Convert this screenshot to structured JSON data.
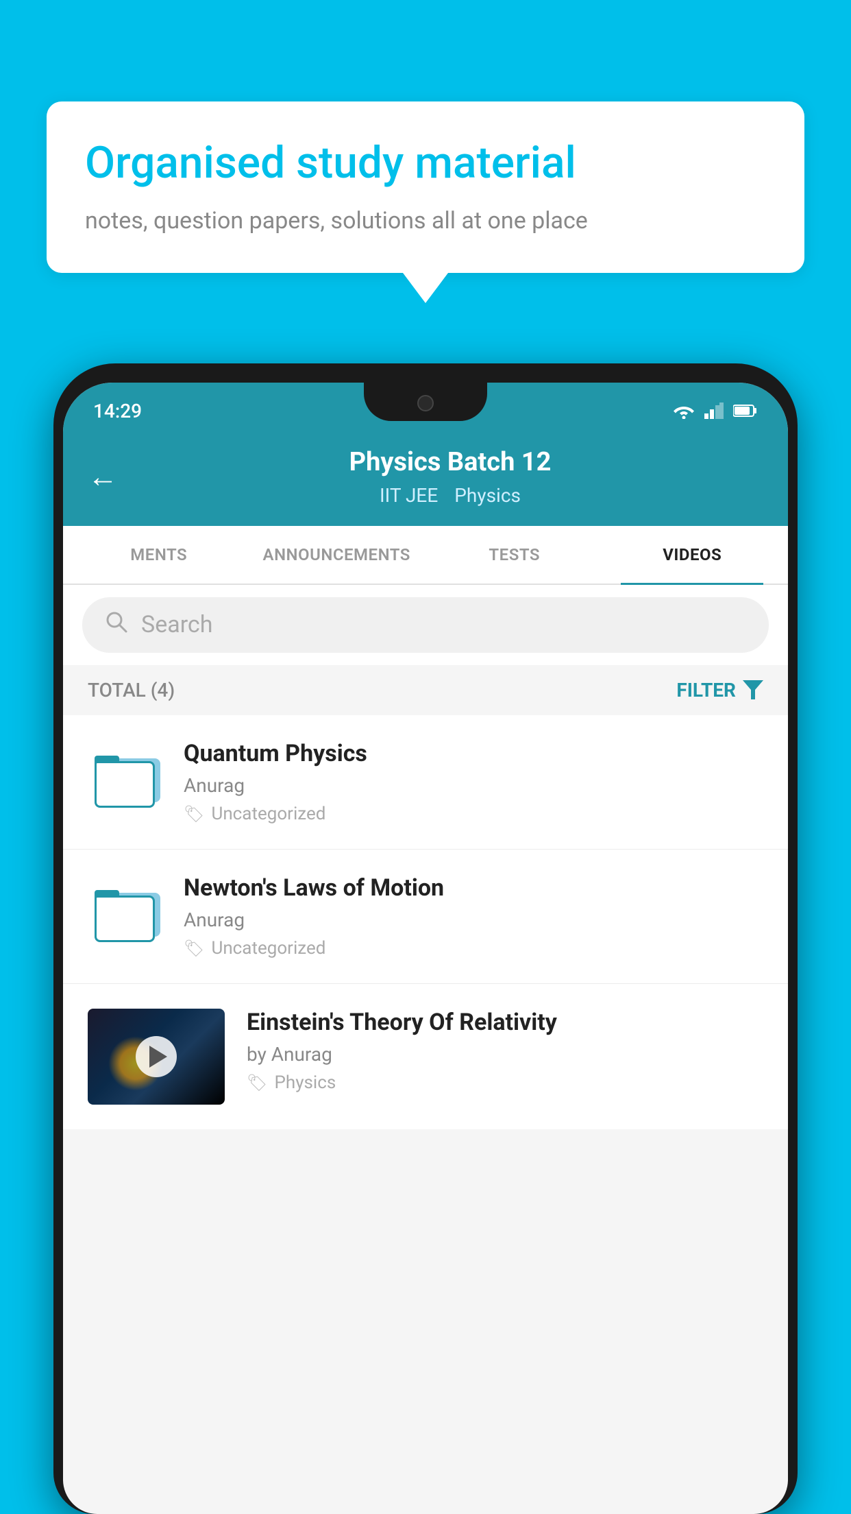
{
  "background": {
    "color": "#00BFEA"
  },
  "bubble": {
    "title": "Organised study material",
    "subtitle": "notes, question papers, solutions all at one place"
  },
  "status_bar": {
    "time": "14:29"
  },
  "header": {
    "title": "Physics Batch 12",
    "tag1": "IIT JEE",
    "tag2": "Physics",
    "back_label": "←"
  },
  "tabs": [
    {
      "label": "MENTS",
      "active": false
    },
    {
      "label": "ANNOUNCEMENTS",
      "active": false
    },
    {
      "label": "TESTS",
      "active": false
    },
    {
      "label": "VIDEOS",
      "active": true
    }
  ],
  "search": {
    "placeholder": "Search"
  },
  "filter_bar": {
    "total_label": "TOTAL (4)",
    "filter_label": "FILTER"
  },
  "videos": [
    {
      "title": "Quantum Physics",
      "author": "Anurag",
      "tag": "Uncategorized",
      "type": "folder"
    },
    {
      "title": "Newton's Laws of Motion",
      "author": "Anurag",
      "tag": "Uncategorized",
      "type": "folder"
    },
    {
      "title": "Einstein's Theory Of Relativity",
      "author": "by Anurag",
      "tag": "Physics",
      "type": "video"
    }
  ]
}
